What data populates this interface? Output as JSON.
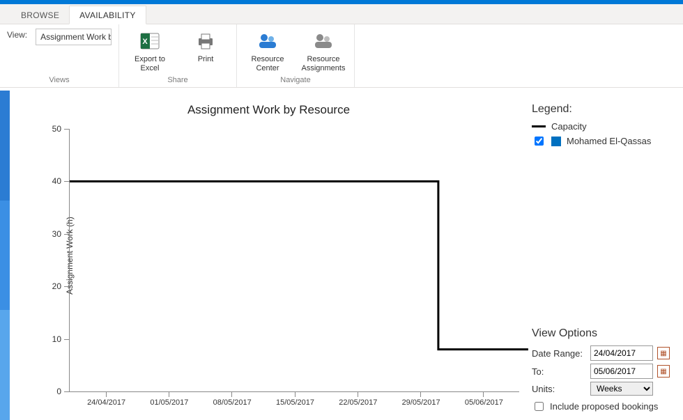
{
  "tabs": {
    "browse": "BROWSE",
    "availability": "AVAILABILITY"
  },
  "ribbon": {
    "views": {
      "label": "View:",
      "selected": "Assignment Work by resour",
      "group": "Views"
    },
    "share": {
      "export": "Export to Excel",
      "print": "Print",
      "group": "Share"
    },
    "navigate": {
      "resource_center": "Resource Center",
      "resource_assignments": "Resource Assignments",
      "group": "Navigate"
    }
  },
  "chart": {
    "title": "Assignment Work by Resource",
    "ylabel": "Assignment Work (h)"
  },
  "chart_data": {
    "type": "line",
    "xlabel": "",
    "ylabel": "Assignment Work (h)",
    "ylim": [
      0,
      50
    ],
    "y_ticks": [
      0,
      10,
      20,
      30,
      40,
      50
    ],
    "x_categories": [
      "24/04/2017",
      "01/05/2017",
      "08/05/2017",
      "15/05/2017",
      "22/05/2017",
      "29/05/2017",
      "05/06/2017"
    ],
    "title": "Assignment Work by Resource",
    "series": [
      {
        "name": "Capacity",
        "style": "black-step",
        "points": [
          {
            "x": "20/04/2017",
            "y": 40
          },
          {
            "x": "31/05/2017",
            "y": 40
          },
          {
            "x": "31/05/2017",
            "y": 8
          },
          {
            "x": "10/06/2017",
            "y": 8
          }
        ]
      }
    ]
  },
  "legend": {
    "title": "Legend:",
    "capacity": "Capacity",
    "resource_checked": true,
    "resource_name": "Mohamed El-Qassas"
  },
  "view_options": {
    "title": "View Options",
    "date_range_label": "Date Range:",
    "date_range_value": "24/04/2017",
    "to_label": "To:",
    "to_value": "05/06/2017",
    "units_label": "Units:",
    "units_value": "Weeks",
    "include_proposed": "Include proposed bookings",
    "include_proposed_checked": false
  }
}
